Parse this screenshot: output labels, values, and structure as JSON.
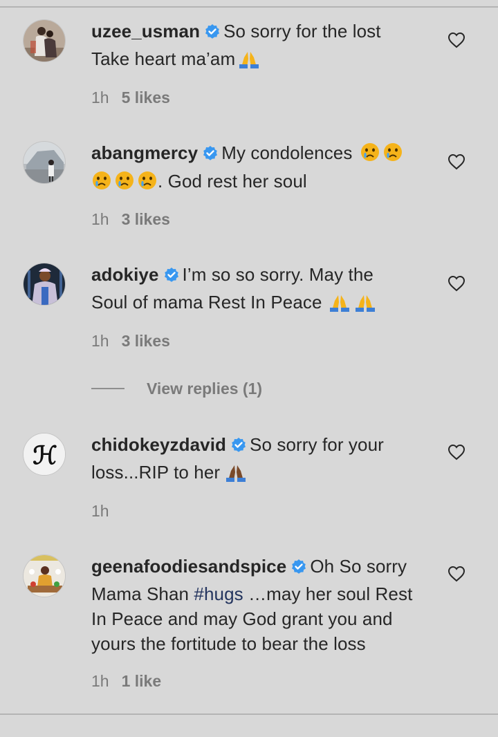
{
  "comments": [
    {
      "username": "uzee_usman",
      "text_line1": "So sorry for the lost",
      "text_line2": "Take heart ma’am",
      "time": "1h",
      "likes": "5 likes"
    },
    {
      "username": "abangmercy",
      "text_line1": "My condolences",
      "text_line2": ". God rest her soul",
      "time": "1h",
      "likes": "3 likes"
    },
    {
      "username": "adokiye",
      "text_line1": "I’m so so sorry. May the",
      "text_line2": "Soul of mama Rest In Peace",
      "time": "1h",
      "likes": "3 likes"
    },
    {
      "username": "chidokeyzdavid",
      "text_line1": "So sorry for your",
      "text_line2": "loss...RIP to her",
      "time": "1h",
      "likes": ""
    },
    {
      "username": "geenafoodiesandspice",
      "text_line1": "Oh So sorry",
      "text_line2_pre": "Mama Shan ",
      "hashtag": "#hugs",
      "text_line2_post": " …may her soul Rest",
      "text_line3": "In Peace and may God grant you and",
      "text_line4": "yours the fortitude to bear the loss",
      "time": "1h",
      "likes": "1 like"
    }
  ],
  "view_replies": "View replies (1)",
  "icons": {
    "verified": "verified-badge-icon",
    "like": "heart-outline-icon",
    "pray": "folded-hands-emoji",
    "cry": "crying-face-emoji"
  },
  "colors": {
    "background": "#d8d8d8",
    "verified": "#3897f0",
    "text": "#262626",
    "meta": "#7a7a7a",
    "hashtag": "#23345e"
  }
}
